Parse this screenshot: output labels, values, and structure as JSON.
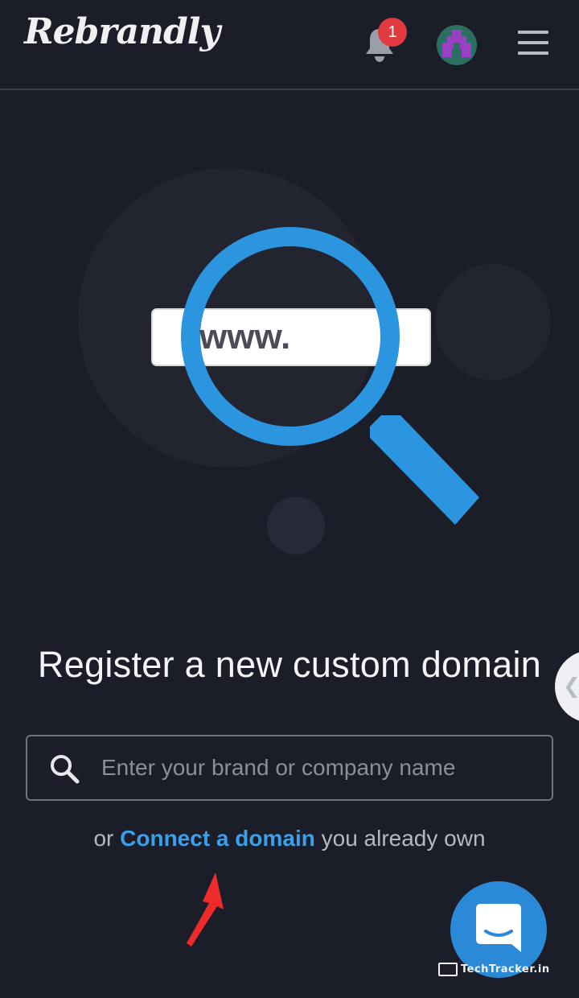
{
  "header": {
    "logo_text": "Rebrandly",
    "notifications_count": "1"
  },
  "illustration": {
    "url_text": "www."
  },
  "main": {
    "title": "Register a new custom domain",
    "search": {
      "placeholder": "Enter your brand or company name",
      "value": ""
    },
    "connect": {
      "prefix": "or ",
      "link_label": "Connect a domain",
      "suffix": " you already own"
    }
  },
  "watermark": {
    "text": "TechTracker.in"
  },
  "colors": {
    "background": "#1b1e29",
    "accent_blue": "#2c95e0",
    "link_blue": "#3d9fe8",
    "badge_red": "#e0393f",
    "chat_blue": "#2a8ad8"
  },
  "icons": {
    "notifications": "bell-icon",
    "menu": "hamburger-icon",
    "search": "search-icon",
    "chat": "chat-icon",
    "collapse": "chevron-left-icon"
  }
}
